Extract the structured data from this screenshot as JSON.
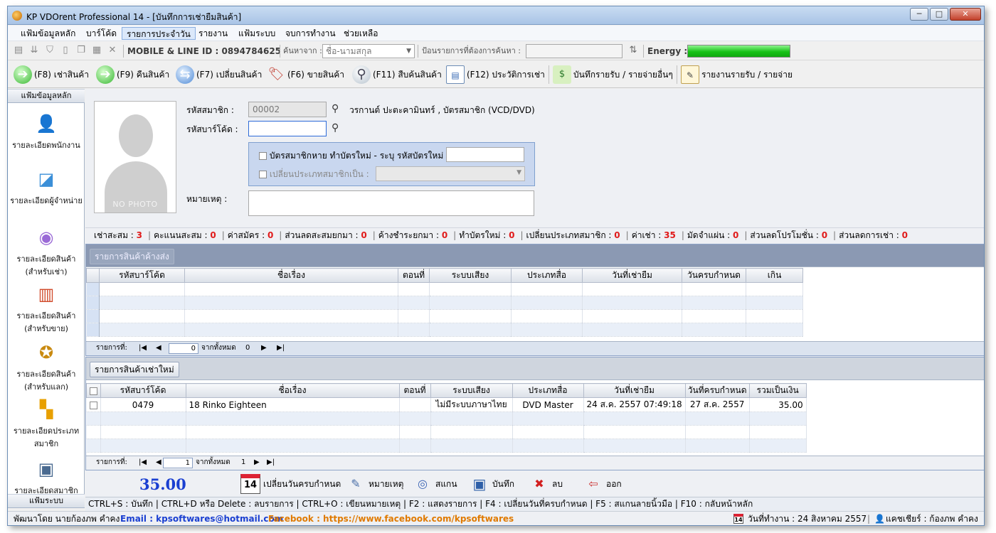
{
  "window": {
    "title": "KP VDOrent Professional 14 - [บันทึกการเช่ายืมสินค้า]",
    "min_label": "─",
    "max_label": "□",
    "close_label": "✕"
  },
  "menu": [
    {
      "label": "แฟ้มข้อมูลหลัก"
    },
    {
      "label": "บาร์โค้ด"
    },
    {
      "label": "รายการประจำวัน"
    },
    {
      "label": "รายงาน"
    },
    {
      "label": "แฟ้มระบบ"
    },
    {
      "label": "จบการทำงาน"
    },
    {
      "label": "ช่วยเหลือ"
    }
  ],
  "toolbar1": {
    "contact": "MOBILE & LINE ID : 0894784625",
    "search_from_label": "ค้นหาจาก :",
    "search_from_value": "ชื่อ-นามสกุล",
    "search_input_label": "ป้อนรายการที่ต้องการค้นหา :",
    "energy_label": "Energy :",
    "energy_level": 1.0,
    "energy_color": "#18c218"
  },
  "toolbar2": [
    {
      "label": "(F8) เช่าสินค้า",
      "icon": "arrow-right-green-icon"
    },
    {
      "label": "(F9) คืนสินค้า",
      "icon": "arrow-left-green-icon"
    },
    {
      "label": "(F7) เปลี่ยนสินค้า",
      "icon": "exchange-icon"
    },
    {
      "label": "(F6) ขายสินค้า",
      "icon": "sale-tag-icon"
    },
    {
      "label": "(F11) สืบค้นสินค้า",
      "icon": "magnifier-icon"
    },
    {
      "label": "(F12) ประวัติการเช่า",
      "icon": "history-icon"
    },
    {
      "label": "บันทึกรายรับ / รายจ่ายอื่นๆ",
      "icon": "money-icon"
    },
    {
      "label": "รายงานรายรับ / รายจ่าย",
      "icon": "clipboard-icon"
    }
  ],
  "sidebar": {
    "header": "แฟ้มข้อมูลหลัก",
    "footer": "แฟ้มระบบ",
    "items": [
      {
        "label": "รายละเอียดพนักงาน",
        "icon": "employee-icon"
      },
      {
        "label": "รายละเอียดผู้จำหน่าย",
        "icon": "supplier-icon"
      },
      {
        "label": "รายละเอียดสินค้า (สำหรับเช่า)",
        "icon": "disc-icon"
      },
      {
        "label": "รายละเอียดสินค้า (สำหรับขาย)",
        "icon": "books-icon"
      },
      {
        "label": "รายละเอียดสินค้า (สำหรับแลก)",
        "icon": "medal-icon"
      },
      {
        "label": "รายละเอียดประเภทสมาชิก",
        "icon": "folder-tree-icon"
      },
      {
        "label": "รายละเอียดสมาชิก",
        "icon": "member-card-icon"
      }
    ]
  },
  "member": {
    "photo_text": "NO PHOTO",
    "member_id_label": "รหัสสมาชิก :",
    "member_id_value": "00002",
    "member_name": "วรกานต์ ปะตะคามินทร์ , บัตรสมาชิก (VCD/DVD)",
    "barcode_label": "รหัสบาร์โค้ด :",
    "barcode_value": "",
    "lost_card_label": "บัตรสมาชิกหาย ทำบัตรใหม่ - ระบุ รหัสบัตรใหม่ :",
    "change_type_label": "เปลี่ยนประเภทสมาชิกเป็น :",
    "note_label": "หมายเหตุ :",
    "note_value": ""
  },
  "summary": [
    {
      "label": "เช่าสะสม :",
      "value": "3"
    },
    {
      "label": "คะแนนสะสม :",
      "value": "0"
    },
    {
      "label": "ค่าสมัคร :",
      "value": "0"
    },
    {
      "label": "ส่วนลดสะสมยกมา :",
      "value": "0"
    },
    {
      "label": "ค้างชำระยกมา :",
      "value": "0"
    },
    {
      "label": "ทำบัตรใหม่ :",
      "value": "0"
    },
    {
      "label": "เปลี่ยนประเภทสมาชิก :",
      "value": "0"
    },
    {
      "label": "ค่าเช่า :",
      "value": "35"
    },
    {
      "label": "มัดจำแผ่น :",
      "value": "0"
    },
    {
      "label": "ส่วนลดโปรโมชั่น :",
      "value": "0"
    },
    {
      "label": "ส่วนลดการเช่า :",
      "value": "0"
    }
  ],
  "pending_panel": {
    "tab": "รายการสินค้าค้างส่ง",
    "columns": [
      "รหัสบาร์โค้ด",
      "ชื่อเรื่อง",
      "ตอนที่",
      "ระบบเสียง",
      "ประเภทสื่อ",
      "วันที่เช่ายืม",
      "วันครบกำหนด",
      "เกิน"
    ],
    "pager_label": "รายการที่:",
    "pager_current": "0",
    "pager_total_label": "จากทั้งหมด",
    "pager_total": "0"
  },
  "new_panel": {
    "tab": "รายการสินค้าเช่าใหม่",
    "columns": [
      "รหัสบาร์โค้ด",
      "ชื่อเรื่อง",
      "ตอนที่",
      "ระบบเสียง",
      "ประเภทสื่อ",
      "วันที่เช่ายืม",
      "วันที่ครบกำหนด",
      "รวมเป็นเงิน"
    ],
    "rows": [
      {
        "barcode": "0479",
        "title": "18 Rinko Eighteen",
        "episode": "",
        "sound": "ไม่มีระบบภาษาไทย",
        "media": "DVD Master",
        "rent_date": "24 ส.ค. 2557 07:49:18",
        "due_date": "27 ส.ค. 2557",
        "amount": "35.00"
      }
    ],
    "pager_label": "รายการที่:",
    "pager_current": "1",
    "pager_total_label": "จากทั้งหมด",
    "pager_total": "1"
  },
  "actions": {
    "total": "35.00",
    "calendar_day": "14",
    "change_due": "เปลี่ยนวันครบกำหนด",
    "note": "หมายเหตุ",
    "scan": "สแกน",
    "save": "บันทึก",
    "delete": "ลบ",
    "exit": "ออก"
  },
  "shortcuts": "CTRL+S : บันทึก  |  CTRL+D หรือ Delete : ลบรายการ  |  CTRL+O : เขียนหมายเหตุ  |  F2 : แสดงรายการ  |  F4 : เปลี่ยนวันที่ครบกำหนด  |  F5 : สแกนลายนิ้วมือ  |  F10 : กลับหน้าหลัก",
  "status": {
    "developer": "พัฒนาโดย นายก้องภพ คำคง",
    "email": "Email : kpsoftwares@hotmail.com",
    "facebook": "Facebook : https://www.facebook.com/kpsoftwares",
    "calendar_day": "14",
    "work_date": "วันที่ทำงาน : 24 สิงหาคม 2557",
    "cashier": "แคชเชียร์ : ก้องภพ คำคง",
    "email_color": "#1a3fd1",
    "facebook_color": "#e07a00"
  }
}
